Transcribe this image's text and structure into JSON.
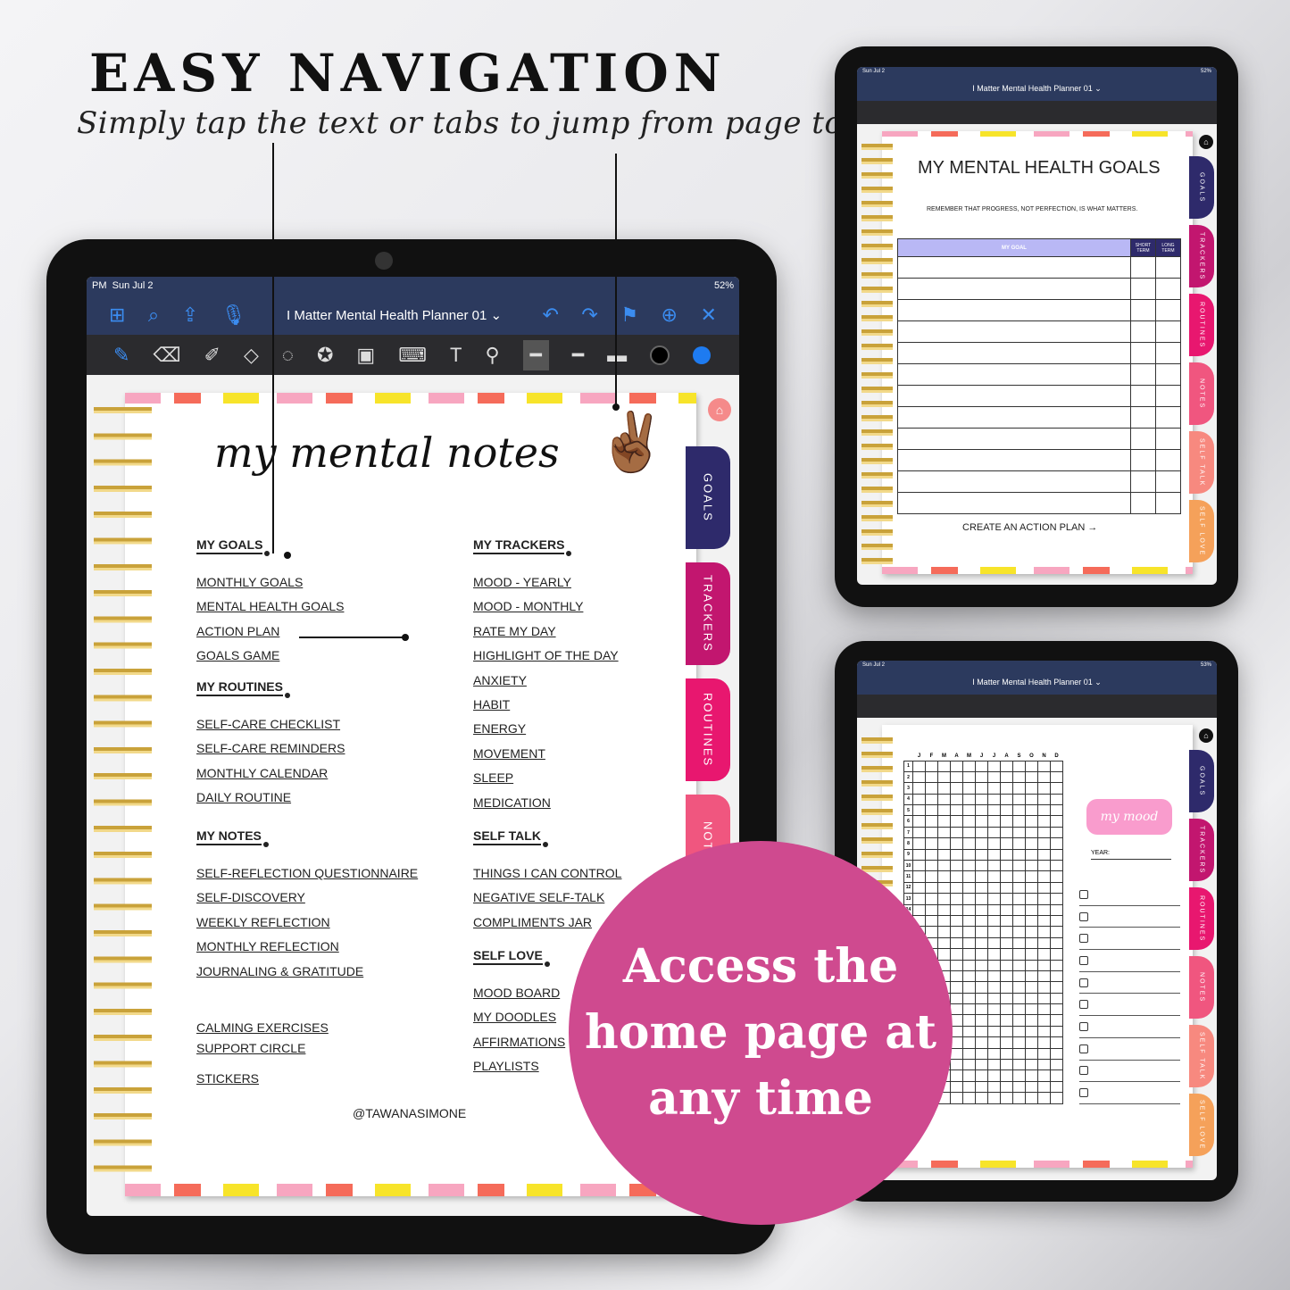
{
  "headline": "EASY NAVIGATION",
  "subtitle": "Simply tap the text or tabs to jump from page to page",
  "callout": "Access the home page at any time",
  "app": {
    "time": "PM",
    "date": "Sun Jul 2",
    "battery": "52%",
    "battery_small": "53%",
    "title": "I Matter Mental Health Planner 01 ⌄"
  },
  "colors": {
    "nav": "#2c3a5e",
    "accent": "#3b8cf0",
    "callout": "#cf4a8f"
  },
  "tabs": [
    {
      "label": "GOALS",
      "color": "#2e2a6b"
    },
    {
      "label": "TRACKERS",
      "color": "#c2166f"
    },
    {
      "label": "ROUTINES",
      "color": "#e8176f"
    },
    {
      "label": "NOTES",
      "color": "#f0567f"
    },
    {
      "label": "SELF TALK",
      "color": "#f7897f"
    },
    {
      "label": "SELF LOVE",
      "color": "#f5a15a"
    }
  ],
  "main": {
    "title": "my mental notes",
    "footer": "@TAWANASIMONE",
    "left": [
      {
        "title": "MY GOALS",
        "items": [
          "MONTHLY GOALS",
          "MENTAL HEALTH GOALS",
          "ACTION PLAN",
          "GOALS GAME"
        ]
      },
      {
        "title": "MY ROUTINES",
        "items": [
          "SELF-CARE CHECKLIST",
          "SELF-CARE REMINDERS",
          "MONTHLY CALENDAR",
          "DAILY ROUTINE"
        ]
      },
      {
        "title": "MY NOTES",
        "items": [
          "SELF-REFLECTION QUESTIONNAIRE",
          "SELF-DISCOVERY",
          "WEEKLY REFLECTION",
          "MONTHLY REFLECTION",
          "JOURNALING & GRATITUDE"
        ]
      }
    ],
    "extra": [
      "CALMING EXERCISES",
      "SUPPORT CIRCLE"
    ],
    "stickers": "STICKERS",
    "right": [
      {
        "title": "MY TRACKERS",
        "items": [
          "MOOD - YEARLY",
          "MOOD - MONTHLY",
          "RATE MY DAY",
          "HIGHLIGHT OF THE DAY",
          "ANXIETY",
          "HABIT",
          "ENERGY",
          "MOVEMENT",
          "SLEEP",
          "MEDICATION"
        ]
      },
      {
        "title": "SELF TALK",
        "items": [
          "THINGS I CAN CONTROL",
          "NEGATIVE SELF-TALK",
          "COMPLIMENTS JAR"
        ]
      },
      {
        "title": "SELF LOVE",
        "items": [
          "MOOD BOARD",
          "MY DOODLES",
          "AFFIRMATIONS",
          "PLAYLISTS"
        ]
      }
    ]
  },
  "goals_page": {
    "title": "MY MENTAL HEALTH GOALS",
    "quote": "REMEMBER THAT PROGRESS, NOT PERFECTION, IS WHAT MATTERS.",
    "col_goal": "MY GOAL",
    "col_short": "SHORT TERM",
    "col_long": "LONG TERM",
    "rows": 12,
    "cta": "CREATE AN ACTION PLAN →"
  },
  "mood_page": {
    "months": [
      "J",
      "F",
      "M",
      "A",
      "M",
      "J",
      "J",
      "A",
      "S",
      "O",
      "N",
      "D"
    ],
    "days": 31,
    "badge": "my mood",
    "year_label": "YEAR:",
    "checkboxes": 10
  }
}
